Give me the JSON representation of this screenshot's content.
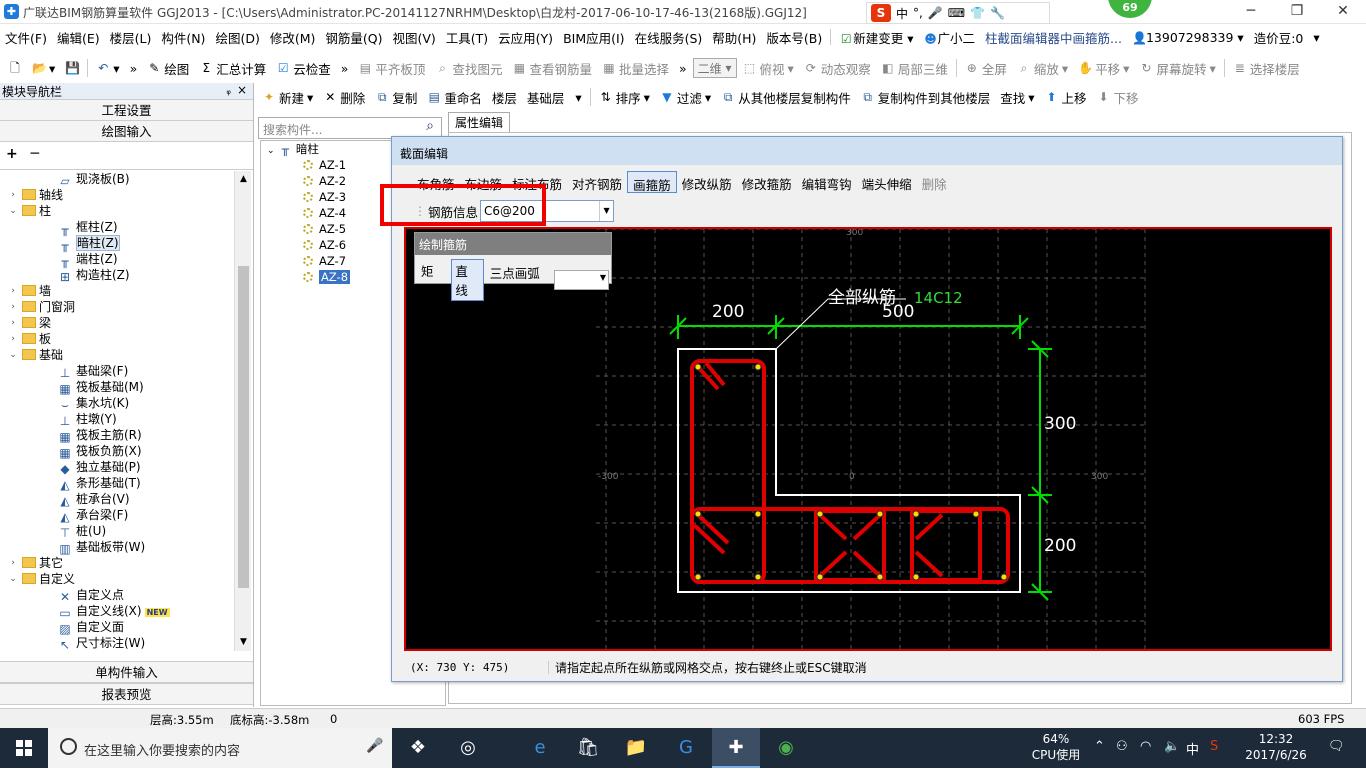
{
  "title": "广联达BIM钢筋算量软件 GGJ2013 - [C:\\Users\\Administrator.PC-20141127NRHM\\Desktop\\白龙村-2017-06-10-17-46-13(2168版).GGJ12]",
  "ime": {
    "zhong": "中",
    "badge": "69"
  },
  "window_controls": {
    "min": "─",
    "max": "❐",
    "close": "✕"
  },
  "menu": [
    "文件(F)",
    "编辑(E)",
    "楼层(L)",
    "构件(N)",
    "绘图(D)",
    "修改(M)",
    "钢筋量(Q)",
    "视图(V)",
    "工具(T)",
    "云应用(Y)",
    "BIM应用(I)",
    "在线服务(S)",
    "帮助(H)",
    "版本号(B)"
  ],
  "menu_extra": {
    "new_change": "新建变更",
    "xiaoer": "广小二",
    "tip": "柱截面编辑器中画箍筋...",
    "phone": "13907298339",
    "price_bean": "造价豆:0"
  },
  "toolbar1": {
    "draw": "绘图",
    "sum": "汇总计算",
    "cloud_check": "云检查",
    "flush_top": "平齐板顶",
    "find_elem": "查找图元",
    "view_rebar": "查看钢筋量",
    "batch_select": "批量选择",
    "view2d": "二维",
    "top_view": "俯视",
    "dynamic_view": "动态观察",
    "local3d": "局部三维",
    "fullscreen": "全屏",
    "zoom": "缩放",
    "pan": "平移",
    "rotate": "屏幕旋转",
    "select_floor": "选择楼层"
  },
  "left_panel": {
    "header": "模块导航栏",
    "pin": "ᵩ",
    "close": "×",
    "project_settings": "工程设置",
    "drawing_input": "绘图输入",
    "single_input": "单构件输入",
    "report_preview": "报表预览",
    "tools": "+ ─",
    "tree": [
      {
        "label": "现浇板(B)",
        "level": 2,
        "type": "comp",
        "icon": "▱"
      },
      {
        "label": "轴线",
        "level": 0,
        "type": "folder",
        "exp": "›"
      },
      {
        "label": "柱",
        "level": 0,
        "type": "folder",
        "exp": "⌄"
      },
      {
        "label": "框柱(Z)",
        "level": 2,
        "type": "comp",
        "icon": "╥"
      },
      {
        "label": "暗柱(Z)",
        "level": 2,
        "type": "comp",
        "icon": "╥",
        "selected": true
      },
      {
        "label": "端柱(Z)",
        "level": 2,
        "type": "comp",
        "icon": "╥"
      },
      {
        "label": "构造柱(Z)",
        "level": 2,
        "type": "comp",
        "icon": "⊞"
      },
      {
        "label": "墙",
        "level": 0,
        "type": "folder",
        "exp": "›"
      },
      {
        "label": "门窗洞",
        "level": 0,
        "type": "folder",
        "exp": "›"
      },
      {
        "label": "梁",
        "level": 0,
        "type": "folder",
        "exp": "›"
      },
      {
        "label": "板",
        "level": 0,
        "type": "folder",
        "exp": "›"
      },
      {
        "label": "基础",
        "level": 0,
        "type": "folder",
        "exp": "⌄"
      },
      {
        "label": "基础梁(F)",
        "level": 2,
        "type": "comp",
        "icon": "⊥"
      },
      {
        "label": "筏板基础(M)",
        "level": 2,
        "type": "comp",
        "icon": "▦"
      },
      {
        "label": "集水坑(K)",
        "level": 2,
        "type": "comp",
        "icon": "⌣"
      },
      {
        "label": "柱墩(Y)",
        "level": 2,
        "type": "comp",
        "icon": "⊥"
      },
      {
        "label": "筏板主筋(R)",
        "level": 2,
        "type": "comp",
        "icon": "▦"
      },
      {
        "label": "筏板负筋(X)",
        "level": 2,
        "type": "comp",
        "icon": "▦"
      },
      {
        "label": "独立基础(P)",
        "level": 2,
        "type": "comp",
        "icon": "◆"
      },
      {
        "label": "条形基础(T)",
        "level": 2,
        "type": "comp",
        "icon": "◭"
      },
      {
        "label": "桩承台(V)",
        "level": 2,
        "type": "comp",
        "icon": "◭"
      },
      {
        "label": "承台梁(F)",
        "level": 2,
        "type": "comp",
        "icon": "◭"
      },
      {
        "label": "桩(U)",
        "level": 2,
        "type": "comp",
        "icon": "⊤"
      },
      {
        "label": "基础板带(W)",
        "level": 2,
        "type": "comp",
        "icon": "▥"
      },
      {
        "label": "其它",
        "level": 0,
        "type": "folder",
        "exp": "›"
      },
      {
        "label": "自定义",
        "level": 0,
        "type": "folder",
        "exp": "⌄"
      },
      {
        "label": "自定义点",
        "level": 2,
        "type": "comp",
        "icon": "✕"
      },
      {
        "label": "自定义线(X)",
        "level": 2,
        "type": "comp",
        "icon": "▭",
        "badge": "NEW"
      },
      {
        "label": "自定义面",
        "level": 2,
        "type": "comp",
        "icon": "▨"
      },
      {
        "label": "尺寸标注(W)",
        "level": 2,
        "type": "comp",
        "icon": "↖"
      }
    ]
  },
  "toolbar2": {
    "new": "新建",
    "delete": "删除",
    "copy": "复制",
    "rename": "重命名",
    "floor": "楼层",
    "base_floor": "基础层",
    "sort": "排序",
    "filter": "过滤",
    "copy_from": "从其他楼层复制构件",
    "copy_to": "复制构件到其他楼层",
    "find": "查找",
    "up": "上移",
    "down": "下移"
  },
  "search": {
    "placeholder": "搜索构件..."
  },
  "comp_tree": {
    "root": "暗柱",
    "items": [
      "AZ-1",
      "AZ-2",
      "AZ-3",
      "AZ-4",
      "AZ-5",
      "AZ-6",
      "AZ-7",
      "AZ-8"
    ],
    "selected": "AZ-8"
  },
  "prop_tab": "属性编辑",
  "dialog": {
    "title": "截面编辑",
    "tabs": [
      "布角筋",
      "布边筋",
      "标注布筋",
      "对齐钢筋",
      "画箍筋",
      "修改纵筋",
      "修改箍筋",
      "编辑弯钩",
      "端头伸缩",
      "删除"
    ],
    "active_tab": "画箍筋",
    "disabled_tabs": [
      "删除"
    ],
    "steel_label": "钢筋信息",
    "steel_value": "C6@200",
    "draw_panel": {
      "title": "绘制箍筋",
      "options": [
        "矩形",
        "直线",
        "三点画弧"
      ],
      "active": "直线"
    },
    "status_coord": "(X: 730 Y: 475)",
    "status_msg": "请指定起点所在纵筋或网格交点，按右键终止或ESC键取消"
  },
  "drawing": {
    "dim_top_left": "200",
    "dim_top_right": "500",
    "dim_right_upper": "300",
    "dim_right_lower": "200",
    "leader_label": "全部纵筋",
    "leader_value": "14C12",
    "grid_labels": {
      "top": "300",
      "left": "-300",
      "center": "0",
      "right": "300"
    },
    "colors": {
      "rebar": "#e00000",
      "dim": "#00dd00",
      "outline": "#ffffff",
      "grid": "#555555"
    }
  },
  "statusbar": {
    "floor_height": "层高:3.55m",
    "base_height": "底标高:-3.58m",
    "zero": "0",
    "fps": "603 FPS"
  },
  "taskbar": {
    "search": "在这里输入你要搜索的内容",
    "cpu_pct": "64%",
    "cpu_label": "CPU使用",
    "time": "12:32",
    "date": "2017/6/26",
    "lang": "中"
  }
}
